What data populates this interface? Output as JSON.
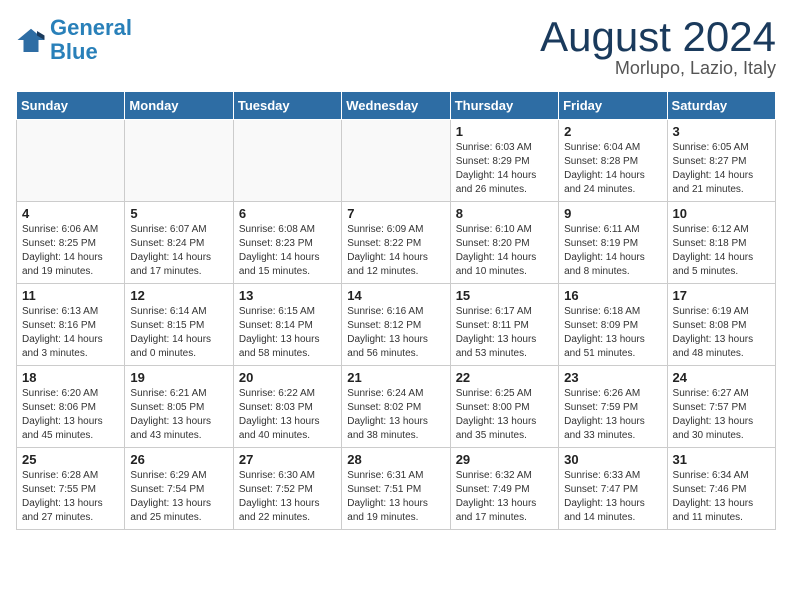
{
  "header": {
    "logo_line1": "General",
    "logo_line2": "Blue",
    "month": "August 2024",
    "location": "Morlupo, Lazio, Italy"
  },
  "days_of_week": [
    "Sunday",
    "Monday",
    "Tuesday",
    "Wednesday",
    "Thursday",
    "Friday",
    "Saturday"
  ],
  "weeks": [
    [
      {
        "day": "",
        "detail": ""
      },
      {
        "day": "",
        "detail": ""
      },
      {
        "day": "",
        "detail": ""
      },
      {
        "day": "",
        "detail": ""
      },
      {
        "day": "1",
        "detail": "Sunrise: 6:03 AM\nSunset: 8:29 PM\nDaylight: 14 hours\nand 26 minutes."
      },
      {
        "day": "2",
        "detail": "Sunrise: 6:04 AM\nSunset: 8:28 PM\nDaylight: 14 hours\nand 24 minutes."
      },
      {
        "day": "3",
        "detail": "Sunrise: 6:05 AM\nSunset: 8:27 PM\nDaylight: 14 hours\nand 21 minutes."
      }
    ],
    [
      {
        "day": "4",
        "detail": "Sunrise: 6:06 AM\nSunset: 8:25 PM\nDaylight: 14 hours\nand 19 minutes."
      },
      {
        "day": "5",
        "detail": "Sunrise: 6:07 AM\nSunset: 8:24 PM\nDaylight: 14 hours\nand 17 minutes."
      },
      {
        "day": "6",
        "detail": "Sunrise: 6:08 AM\nSunset: 8:23 PM\nDaylight: 14 hours\nand 15 minutes."
      },
      {
        "day": "7",
        "detail": "Sunrise: 6:09 AM\nSunset: 8:22 PM\nDaylight: 14 hours\nand 12 minutes."
      },
      {
        "day": "8",
        "detail": "Sunrise: 6:10 AM\nSunset: 8:20 PM\nDaylight: 14 hours\nand 10 minutes."
      },
      {
        "day": "9",
        "detail": "Sunrise: 6:11 AM\nSunset: 8:19 PM\nDaylight: 14 hours\nand 8 minutes."
      },
      {
        "day": "10",
        "detail": "Sunrise: 6:12 AM\nSunset: 8:18 PM\nDaylight: 14 hours\nand 5 minutes."
      }
    ],
    [
      {
        "day": "11",
        "detail": "Sunrise: 6:13 AM\nSunset: 8:16 PM\nDaylight: 14 hours\nand 3 minutes."
      },
      {
        "day": "12",
        "detail": "Sunrise: 6:14 AM\nSunset: 8:15 PM\nDaylight: 14 hours\nand 0 minutes."
      },
      {
        "day": "13",
        "detail": "Sunrise: 6:15 AM\nSunset: 8:14 PM\nDaylight: 13 hours\nand 58 minutes."
      },
      {
        "day": "14",
        "detail": "Sunrise: 6:16 AM\nSunset: 8:12 PM\nDaylight: 13 hours\nand 56 minutes."
      },
      {
        "day": "15",
        "detail": "Sunrise: 6:17 AM\nSunset: 8:11 PM\nDaylight: 13 hours\nand 53 minutes."
      },
      {
        "day": "16",
        "detail": "Sunrise: 6:18 AM\nSunset: 8:09 PM\nDaylight: 13 hours\nand 51 minutes."
      },
      {
        "day": "17",
        "detail": "Sunrise: 6:19 AM\nSunset: 8:08 PM\nDaylight: 13 hours\nand 48 minutes."
      }
    ],
    [
      {
        "day": "18",
        "detail": "Sunrise: 6:20 AM\nSunset: 8:06 PM\nDaylight: 13 hours\nand 45 minutes."
      },
      {
        "day": "19",
        "detail": "Sunrise: 6:21 AM\nSunset: 8:05 PM\nDaylight: 13 hours\nand 43 minutes."
      },
      {
        "day": "20",
        "detail": "Sunrise: 6:22 AM\nSunset: 8:03 PM\nDaylight: 13 hours\nand 40 minutes."
      },
      {
        "day": "21",
        "detail": "Sunrise: 6:24 AM\nSunset: 8:02 PM\nDaylight: 13 hours\nand 38 minutes."
      },
      {
        "day": "22",
        "detail": "Sunrise: 6:25 AM\nSunset: 8:00 PM\nDaylight: 13 hours\nand 35 minutes."
      },
      {
        "day": "23",
        "detail": "Sunrise: 6:26 AM\nSunset: 7:59 PM\nDaylight: 13 hours\nand 33 minutes."
      },
      {
        "day": "24",
        "detail": "Sunrise: 6:27 AM\nSunset: 7:57 PM\nDaylight: 13 hours\nand 30 minutes."
      }
    ],
    [
      {
        "day": "25",
        "detail": "Sunrise: 6:28 AM\nSunset: 7:55 PM\nDaylight: 13 hours\nand 27 minutes."
      },
      {
        "day": "26",
        "detail": "Sunrise: 6:29 AM\nSunset: 7:54 PM\nDaylight: 13 hours\nand 25 minutes."
      },
      {
        "day": "27",
        "detail": "Sunrise: 6:30 AM\nSunset: 7:52 PM\nDaylight: 13 hours\nand 22 minutes."
      },
      {
        "day": "28",
        "detail": "Sunrise: 6:31 AM\nSunset: 7:51 PM\nDaylight: 13 hours\nand 19 minutes."
      },
      {
        "day": "29",
        "detail": "Sunrise: 6:32 AM\nSunset: 7:49 PM\nDaylight: 13 hours\nand 17 minutes."
      },
      {
        "day": "30",
        "detail": "Sunrise: 6:33 AM\nSunset: 7:47 PM\nDaylight: 13 hours\nand 14 minutes."
      },
      {
        "day": "31",
        "detail": "Sunrise: 6:34 AM\nSunset: 7:46 PM\nDaylight: 13 hours\nand 11 minutes."
      }
    ]
  ]
}
